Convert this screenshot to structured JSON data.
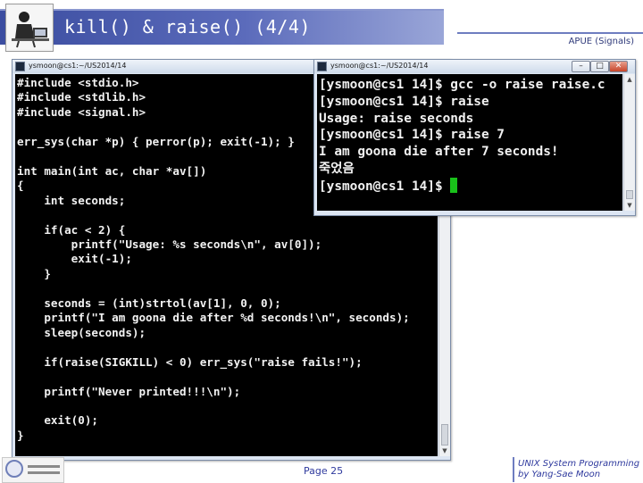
{
  "slide": {
    "title": "kill() & raise() (4/4)",
    "course_tag": "APUE (Signals)",
    "page": "Page 25",
    "footer_line1": "UNIX System Programming",
    "footer_line2": "by Yang-Sae Moon"
  },
  "code_window": {
    "title": "ysmoon@cs1:~/US2014/14",
    "code": "#include <stdio.h>\n#include <stdlib.h>\n#include <signal.h>\n\nerr_sys(char *p) { perror(p); exit(-1); }\n\nint main(int ac, char *av[])\n{\n    int seconds;\n\n    if(ac < 2) {\n        printf(\"Usage: %s seconds\\n\", av[0]);\n        exit(-1);\n    }\n\n    seconds = (int)strtol(av[1], 0, 0);\n    printf(\"I am goona die after %d seconds!\\n\", seconds);\n    sleep(seconds);\n\n    if(raise(SIGKILL) < 0) err_sys(\"raise fails!\");\n\n    printf(\"Never printed!!!\\n\");\n\n    exit(0);\n}"
  },
  "terminal_window": {
    "title": "ysmoon@cs1:~/US2014/14",
    "lines": [
      "[ysmoon@cs1 14]$ gcc -o raise raise.c",
      "[ysmoon@cs1 14]$ raise",
      "Usage: raise seconds",
      "[ysmoon@cs1 14]$ raise 7",
      "I am goona die after 7 seconds!",
      "죽었음",
      "[ysmoon@cs1 14]$ "
    ],
    "cursor_color": "#19c11a"
  },
  "window_buttons": {
    "minimize": "–",
    "maximize": "□",
    "close": "✕"
  },
  "icons": {
    "logo": "person-at-computer-icon",
    "window": "terminal-icon",
    "scroll_up": "arrow-up-icon",
    "scroll_down": "arrow-down-icon"
  },
  "colors": {
    "accent": "#3b4da0",
    "footer_text": "#2f3a9e",
    "terminal_bg": "#000000",
    "terminal_fg": "#f2f2f2"
  }
}
